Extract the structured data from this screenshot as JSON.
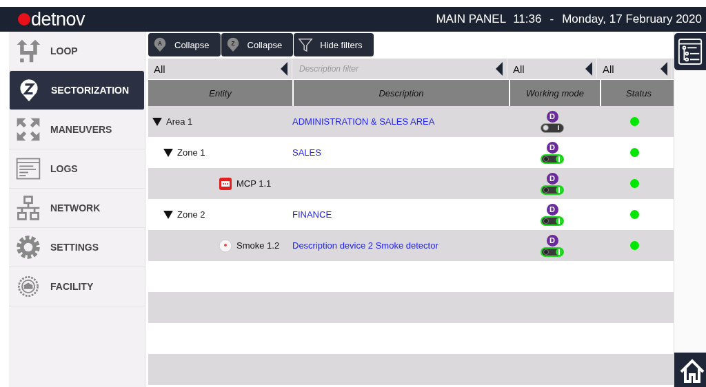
{
  "header": {
    "brand": "detnov",
    "title": "MAIN PANEL",
    "time": "11:36",
    "separator": "-",
    "date": "Monday, 17 February 2020"
  },
  "sidebar": {
    "items": [
      {
        "label": "LOOP",
        "kind": "loop",
        "selected": false
      },
      {
        "label": "SECTORIZATION",
        "kind": "zone",
        "selected": true
      },
      {
        "label": "MANEUVERS",
        "kind": "maneuvers",
        "selected": false
      },
      {
        "label": "LOGS",
        "kind": "logs",
        "selected": false
      },
      {
        "label": "NETWORK",
        "kind": "network",
        "selected": false
      },
      {
        "label": "SETTINGS",
        "kind": "settings",
        "selected": false
      },
      {
        "label": "FACILITY",
        "kind": "facility",
        "selected": false
      }
    ]
  },
  "toolbar": [
    {
      "label": "Collapse",
      "kind": "pin",
      "badge": "A"
    },
    {
      "label": "Collapse",
      "kind": "pin",
      "badge": "Z"
    },
    {
      "label": "Hide filters",
      "kind": "filter"
    }
  ],
  "filters": [
    {
      "kind": "select",
      "value": "All"
    },
    {
      "kind": "text",
      "placeholder": "Description filter"
    },
    {
      "kind": "select",
      "value": "All"
    },
    {
      "kind": "select",
      "value": "All"
    }
  ],
  "table": {
    "columns": [
      "Entity",
      "Description",
      "Working mode",
      "Status"
    ],
    "rows": [
      {
        "entity": "Area 1",
        "kind": "group",
        "expanded": true,
        "description": "ADMINISTRATION & SALES AREA",
        "mode": "D",
        "on": false,
        "color": "#00e600",
        "children": [
          {
            "entity": "Zone 1",
            "kind": "group",
            "expanded": true,
            "description": "SALES",
            "mode": "D",
            "on": true,
            "color": "#00e600",
            "children": [
              {
                "entity": "MCP 1.1",
                "kind": "call-point",
                "mode": "D",
                "on": true,
                "color": "#00e600"
              }
            ]
          },
          {
            "entity": "Zone 2",
            "kind": "group",
            "expanded": true,
            "description": "FINANCE",
            "mode": "D",
            "on": true,
            "color": "#00e600",
            "children": [
              {
                "entity": "Smoke 1.2",
                "kind": "smoke-detector",
                "description": "Description device 2 Smoke detector",
                "mode": "D",
                "on": true,
                "color": "#00e600"
              }
            ]
          }
        ]
      }
    ]
  }
}
